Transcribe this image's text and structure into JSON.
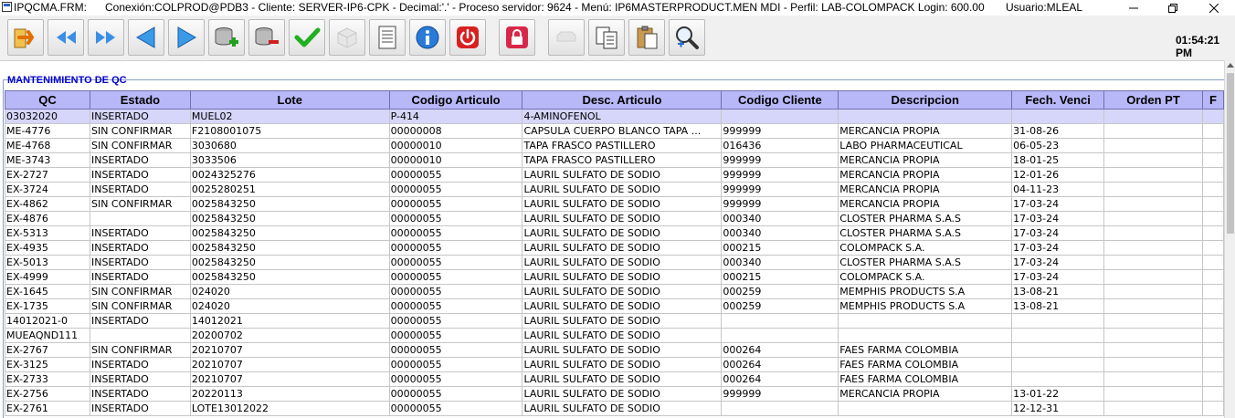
{
  "window": {
    "title": "IPQCMA.FRM:      Conexión:COLPROD@PDB3 - Cliente: SERVER-IP6-CPK - Decimal:'.' - Proceso servidor: 9624 - Menú: IP6MASTERPRODUCT.MEN MDI - Perfil: LAB-COLOMPACK Login: 600.00       Usuario:MLEAL"
  },
  "toolbar": {
    "buttons": [
      {
        "name": "exit-button",
        "icon": "exit-arrow-icon"
      },
      {
        "name": "first-record-button",
        "icon": "double-left-arrow-icon"
      },
      {
        "name": "last-record-button",
        "icon": "double-right-arrow-icon"
      },
      {
        "name": "previous-record-button",
        "icon": "left-triangle-icon"
      },
      {
        "name": "next-record-button",
        "icon": "right-triangle-icon"
      },
      {
        "name": "add-record-button",
        "icon": "database-add-icon"
      },
      {
        "name": "delete-record-button",
        "icon": "database-remove-icon"
      },
      {
        "name": "confirm-button",
        "icon": "checkmark-icon"
      },
      {
        "name": "cancel-button",
        "icon": "cube-icon"
      },
      {
        "name": "print-button",
        "icon": "document-icon"
      },
      {
        "name": "info-button",
        "icon": "info-icon"
      },
      {
        "name": "power-button",
        "icon": "power-icon"
      },
      {
        "name": "lock-button",
        "icon": "lock-icon"
      },
      {
        "name": "disabled-button",
        "icon": "tray-icon"
      },
      {
        "name": "copy-button",
        "icon": "copy-icon"
      },
      {
        "name": "paste-button",
        "icon": "clipboard-icon"
      },
      {
        "name": "zoom-button",
        "icon": "magnifier-icon"
      }
    ],
    "clock": "01:54:21 PM"
  },
  "section": {
    "title": "MANTENIMIENTO DE QC"
  },
  "grid": {
    "columns": [
      "QC",
      "Estado",
      "Lote",
      "Codigo Articulo",
      "Desc. Articulo",
      "Codigo Cliente",
      "Descripcion",
      "Fech. Venci",
      "Orden PT",
      "F"
    ],
    "rows": [
      [
        "03032020",
        "INSERTADO",
        "MUEL02",
        "P-414",
        "4-AMINOFENOL",
        "",
        "",
        "",
        "",
        ""
      ],
      [
        "ME-4776",
        "SIN CONFIRMAR",
        "F2108001075",
        "00000008",
        "CAPSULA CUERPO BLANCO TAPA ...",
        "999999",
        "MERCANCIA PROPIA",
        "31-08-26",
        "",
        ""
      ],
      [
        "ME-4768",
        "SIN CONFIRMAR",
        "3030680",
        "00000010",
        "TAPA FRASCO PASTILLERO",
        "016436",
        "LABO PHARMACEUTICAL",
        "06-05-23",
        "",
        ""
      ],
      [
        "ME-3743",
        "INSERTADO",
        "3033506",
        "00000010",
        "TAPA FRASCO PASTILLERO",
        "999999",
        "MERCANCIA PROPIA",
        "18-01-25",
        "",
        ""
      ],
      [
        "EX-2727",
        "INSERTADO",
        "0024325276",
        "00000055",
        "LAURIL SULFATO DE SODIO",
        "999999",
        "MERCANCIA PROPIA",
        "12-01-26",
        "",
        ""
      ],
      [
        "EX-3724",
        "INSERTADO",
        "0025280251",
        "00000055",
        "LAURIL SULFATO DE SODIO",
        "999999",
        "MERCANCIA PROPIA",
        "04-11-23",
        "",
        ""
      ],
      [
        "EX-4862",
        "SIN CONFIRMAR",
        "0025843250",
        "00000055",
        "LAURIL SULFATO DE SODIO",
        "999999",
        "MERCANCIA PROPIA",
        "17-03-24",
        "",
        ""
      ],
      [
        "EX-4876",
        "",
        "0025843250",
        "00000055",
        "LAURIL SULFATO DE SODIO",
        "000340",
        "CLOSTER PHARMA S.A.S",
        "17-03-24",
        "",
        ""
      ],
      [
        "EX-5313",
        "INSERTADO",
        "0025843250",
        "00000055",
        "LAURIL SULFATO DE SODIO",
        "000340",
        "CLOSTER PHARMA S.A.S",
        "17-03-24",
        "",
        ""
      ],
      [
        "EX-4935",
        "INSERTADO",
        "0025843250",
        "00000055",
        "LAURIL SULFATO DE SODIO",
        "000215",
        "COLOMPACK S.A.",
        "17-03-24",
        "",
        ""
      ],
      [
        "EX-5013",
        "INSERTADO",
        "0025843250",
        "00000055",
        "LAURIL SULFATO DE SODIO",
        "000340",
        "CLOSTER PHARMA S.A.S",
        "17-03-24",
        "",
        ""
      ],
      [
        "EX-4999",
        "INSERTADO",
        "0025843250",
        "00000055",
        "LAURIL SULFATO DE SODIO",
        "000215",
        "COLOMPACK S.A.",
        "17-03-24",
        "",
        ""
      ],
      [
        "EX-1645",
        "SIN CONFIRMAR",
        "024020",
        "00000055",
        "LAURIL SULFATO DE SODIO",
        "000259",
        "MEMPHIS PRODUCTS S.A",
        "13-08-21",
        "",
        ""
      ],
      [
        "EX-1735",
        "SIN CONFIRMAR",
        "024020",
        "00000055",
        "LAURIL SULFATO DE SODIO",
        "000259",
        "MEMPHIS PRODUCTS S.A",
        "13-08-21",
        "",
        ""
      ],
      [
        "14012021-0",
        "INSERTADO",
        "14012021",
        "00000055",
        "LAURIL SULFATO DE SODIO",
        "",
        "",
        "",
        "",
        ""
      ],
      [
        "MUEAQND111",
        "",
        "20200702",
        "00000055",
        "LAURIL SULFATO DE SODIO",
        "",
        "",
        "",
        "",
        ""
      ],
      [
        "EX-2767",
        "SIN CONFIRMAR",
        "20210707",
        "00000055",
        "LAURIL SULFATO DE SODIO",
        "000264",
        "FAES FARMA COLOMBIA",
        "",
        "",
        ""
      ],
      [
        "EX-3125",
        "INSERTADO",
        "20210707",
        "00000055",
        "LAURIL SULFATO DE SODIO",
        "000264",
        "FAES FARMA COLOMBIA",
        "",
        "",
        ""
      ],
      [
        "EX-2733",
        "INSERTADO",
        "20210707",
        "00000055",
        "LAURIL SULFATO DE SODIO",
        "000264",
        "FAES FARMA COLOMBIA",
        "",
        "",
        ""
      ],
      [
        "EX-2756",
        "INSERTADO",
        "20220113",
        "00000055",
        "LAURIL SULFATO DE SODIO",
        "999999",
        "MERCANCIA PROPIA",
        "13-01-22",
        "",
        ""
      ],
      [
        "EX-2761",
        "INSERTADO",
        "LOTE13012022",
        "00000055",
        "LAURIL SULFATO DE SODIO",
        "",
        "",
        "12-12-31",
        "",
        ""
      ]
    ],
    "selected_row": 0
  },
  "colors": {
    "header_bg": "#b8b8f8",
    "selected_row_bg": "#d6d6fa",
    "section_title": "#0000cc"
  }
}
